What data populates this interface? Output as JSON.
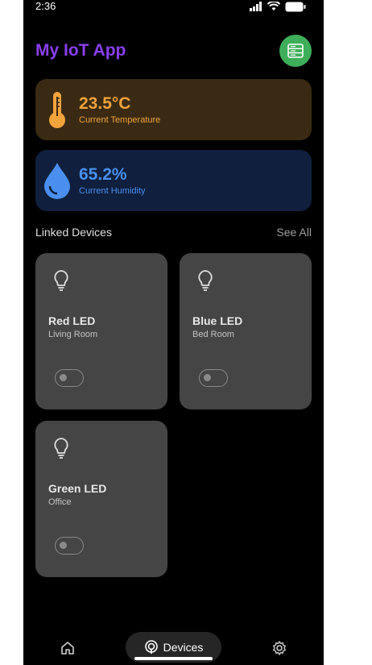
{
  "status_bar": {
    "time": "2:36"
  },
  "header": {
    "title": "My IoT App",
    "action_icon": "server-icon"
  },
  "sensors": {
    "temperature": {
      "value": "23.5°C",
      "label": "Current Temperature",
      "icon": "thermometer-icon",
      "color": "#f2a33c"
    },
    "humidity": {
      "value": "65.2%",
      "label": "Current Humidity",
      "icon": "water-drop-icon",
      "color": "#4a8ff0"
    }
  },
  "devices_section": {
    "title": "Linked Devices",
    "see_all": "See All"
  },
  "devices": [
    {
      "name": "Red LED",
      "room": "Living Room",
      "on": false
    },
    {
      "name": "Blue LED",
      "room": "Bed Room",
      "on": false
    },
    {
      "name": "Green LED",
      "room": "Office",
      "on": false
    }
  ],
  "bottom_nav": {
    "home_icon": "home-icon",
    "devices_label": "Devices",
    "settings_icon": "gear-icon"
  },
  "colors": {
    "accent": "#8a3ff0",
    "header_button": "#3fae5a",
    "card": "#454545"
  }
}
